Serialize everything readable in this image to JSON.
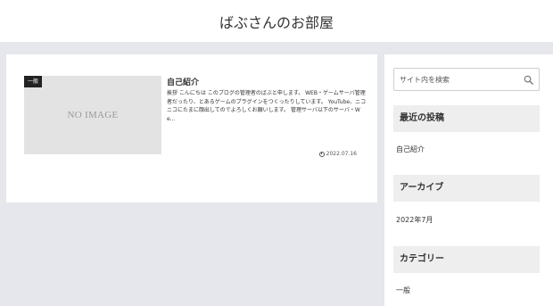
{
  "header": {
    "site_title": "ばぶさんのお部屋"
  },
  "post": {
    "category_badge": "一般",
    "thumbnail_text": "NO IMAGE",
    "title": "自己紹介",
    "snippet": "挨拶 こんにちは このブログの管理者のばぶと申します。 WEB・ゲームサーバ管理者だったり、とあるゲームのプラグインをつくったりしています。 YouTube、ニコニコにたまに顔出してのでよろしくお願いします。 管理サーバ以下のサーバ・We...",
    "date": "2022.07.16",
    "date_icon": "clock-icon"
  },
  "sidebar": {
    "search": {
      "placeholder": "サイト内を検索",
      "value": "",
      "icon": "search-icon"
    },
    "recent": {
      "heading": "最近の投稿",
      "items": [
        "自己紹介"
      ]
    },
    "archive": {
      "heading": "アーカイブ",
      "items": [
        "2022年7月"
      ]
    },
    "category": {
      "heading": "カテゴリー",
      "items": [
        "一般"
      ]
    }
  }
}
